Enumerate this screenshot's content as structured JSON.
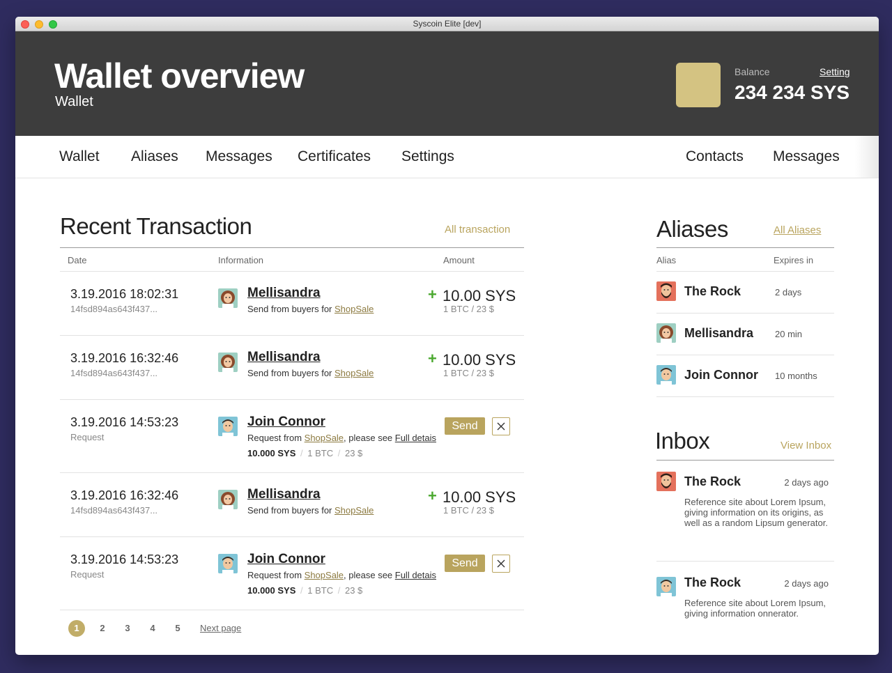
{
  "window": {
    "title": "Syscoin Elite [dev]"
  },
  "header": {
    "title": "Wallet overview",
    "subtitle": "Wallet",
    "balance_label": "Balance",
    "setting_label": "Setting",
    "balance_value": "234 234 SYS",
    "balance_swatch_color": "#d4c382"
  },
  "nav": {
    "left": [
      "Wallet",
      "Aliases",
      "Messages",
      "Certificates",
      "Settings"
    ],
    "right": [
      "Contacts",
      "Messages"
    ]
  },
  "transactions": {
    "title": "Recent Transaction",
    "all_link": "All transaction",
    "columns": [
      "Date",
      "Information",
      "Amount"
    ],
    "rows": [
      {
        "type": "received",
        "date": "3.19.2016 18:02:31",
        "sub": "14fsd894as643f437...",
        "avatar": "female-avatar-icon",
        "name": "Mellisandra",
        "desc_prefix": "Send from buyers for ",
        "desc_link": "ShopSale",
        "plus": "+",
        "amount": "10.00 SYS",
        "amount_sub": "1 BTC / 23 $"
      },
      {
        "type": "received",
        "date": "3.19.2016 16:32:46",
        "sub": "14fsd894as643f437...",
        "avatar": "female-avatar-icon",
        "name": "Mellisandra",
        "desc_prefix": "Send from buyers for ",
        "desc_link": "ShopSale",
        "plus": "+",
        "amount": "10.00 SYS",
        "amount_sub": "1 BTC / 23 $"
      },
      {
        "type": "request",
        "date": "3.19.2016 14:53:23",
        "sub": "Request",
        "avatar": "male-avatar-icon",
        "name": "Join Connor",
        "desc_prefix": "Request from ",
        "desc_link": "ShopSale",
        "desc_mid": ", please see ",
        "desc_link2": "Full detais",
        "meta_sys": "10.000 SYS",
        "meta_sep": "/",
        "meta_btc": "1 BTC",
        "meta_usd": "23 $",
        "send_label": "Send",
        "close_label": "×"
      },
      {
        "type": "received",
        "date": "3.19.2016 16:32:46",
        "sub": "14fsd894as643f437...",
        "avatar": "female-avatar-icon",
        "name": "Mellisandra",
        "desc_prefix": "Send from buyers for ",
        "desc_link": "ShopSale",
        "plus": "+",
        "amount": "10.00 SYS",
        "amount_sub": "1 BTC / 23 $"
      },
      {
        "type": "request",
        "date": "3.19.2016 14:53:23",
        "sub": "Request",
        "avatar": "male-avatar-icon",
        "name": "Join Connor",
        "desc_prefix": "Request from ",
        "desc_link": "ShopSale",
        "desc_mid": ", please see ",
        "desc_link2": "Full detais",
        "meta_sys": "10.000 SYS",
        "meta_sep": "/",
        "meta_btc": "1 BTC",
        "meta_usd": "23 $",
        "send_label": "Send",
        "close_label": "×"
      }
    ],
    "pagination": {
      "pages": [
        "1",
        "2",
        "3",
        "4",
        "5"
      ],
      "active": "1",
      "next_label": "Next page"
    }
  },
  "aliases": {
    "title": "Aliases",
    "all_link": "All Aliases",
    "columns": [
      "Alias",
      "Expires in"
    ],
    "rows": [
      {
        "avatar": "bearded-man-avatar-icon",
        "name": "The Rock",
        "expires": "2 days"
      },
      {
        "avatar": "female-avatar-icon",
        "name": "Mellisandra",
        "expires": "20 min"
      },
      {
        "avatar": "male-avatar-icon",
        "name": "Join Connor",
        "expires": "10 months"
      }
    ]
  },
  "inbox": {
    "title": "Inbox",
    "view_link": "View Inbox",
    "messages": [
      {
        "avatar": "bearded-man-avatar-icon",
        "name": "The Rock",
        "time": "2 days ago",
        "body": "Reference site about Lorem Ipsum, giving information on its origins, as well as a random Lipsum generator."
      },
      {
        "avatar": "male-avatar-icon",
        "name": "The Rock",
        "time": "2 days ago",
        "body": "Reference site about Lorem Ipsum, giving information onnerator."
      }
    ]
  },
  "colors": {
    "accent": "#b9a45e",
    "header_bg": "#3d3d3d",
    "positive": "#4aa82e",
    "desktop_bg": "#2f2c5f"
  }
}
